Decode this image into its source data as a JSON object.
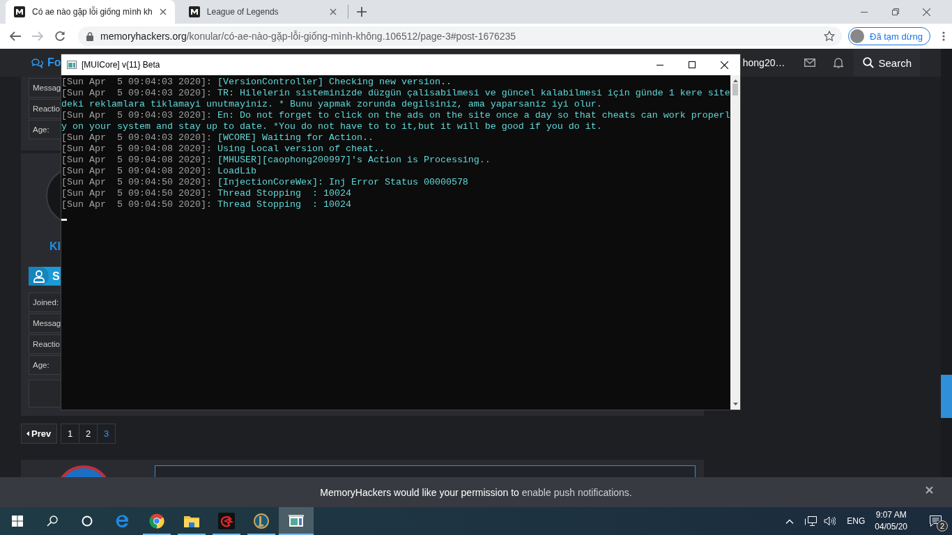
{
  "browser": {
    "tabs": [
      {
        "title": "Có ae nào gặp lỗi giống mình kh",
        "selected": true
      },
      {
        "title": "League of Legends",
        "selected": false
      }
    ],
    "address": {
      "host": "memoryhackers.org",
      "path": "/konular/có-ae-nào-gặp-lỗi-giống-mình-không.106512/page-3#post-1676235"
    },
    "profile": {
      "label": "Đã tạm dừng"
    }
  },
  "forum": {
    "nav": {
      "brand": "Fo",
      "user": "hong20…",
      "search": "Search"
    },
    "posts": [
      {
        "fields": [
          "Messag",
          "Reactio",
          "Age:"
        ]
      },
      {
        "name": "KI",
        "banner": "S",
        "fields": [
          "Joined:",
          "Messag",
          "Reactio",
          "Age:"
        ]
      }
    ],
    "pagination": {
      "prev": "Prev",
      "pages": [
        {
          "label": "1",
          "selected": false
        },
        {
          "label": "2",
          "selected": false
        },
        {
          "label": "3",
          "selected": true
        }
      ]
    }
  },
  "console": {
    "title": "[MUICore] v{11} Beta",
    "lines": [
      {
        "time": "[Sun Apr  5 09:04:03 2020]:",
        "message": "[VersionController] Checking new version.."
      },
      {
        "time": "[Sun Apr  5 09:04:03 2020]:",
        "message": "TR: Hilelerin sisteminizde düzgün çalisabilmesi ve güncel kalabilmesi için günde 1 kere sitedeki reklamlara tiklamayi unutmayiniz. * Bunu yapmak zorunda degilsiniz, ama yaparsaniz iyi olur."
      },
      {
        "time": "[Sun Apr  5 09:04:03 2020]:",
        "message": "En: Do not forget to click on the ads on the site once a day so that cheats can work properly on your system and stay up to date. *You do not have to to it,but it will be good if you do it."
      },
      {
        "time": "[Sun Apr  5 09:04:03 2020]:",
        "message": "[WCORE] Waiting for Action.."
      },
      {
        "time": "[Sun Apr  5 09:04:08 2020]:",
        "message": "Using Local version of cheat.."
      },
      {
        "time": "[Sun Apr  5 09:04:08 2020]:",
        "message": "[MHUSER][caophong200997]'s Action is Processing.."
      },
      {
        "time": "[Sun Apr  5 09:04:08 2020]:",
        "message": "LoadLib"
      },
      {
        "time": "[Sun Apr  5 09:04:50 2020]:",
        "message": "[InjectionCoreWex]: Inj Error Status 00000578"
      },
      {
        "time": "[Sun Apr  5 09:04:50 2020]:",
        "message": "Thread Stopping  : 10024"
      },
      {
        "time": "[Sun Apr  5 09:04:50 2020]:",
        "message": "Thread Stopping  : 10024"
      }
    ]
  },
  "notification": {
    "text": "**MemoryHackers would like your permission to** enable push notifications."
  },
  "taskbar": {
    "apps": [
      {
        "kind": "edge",
        "running": false,
        "selected": false
      },
      {
        "kind": "chrome",
        "running": true,
        "selected": false
      },
      {
        "kind": "explorer",
        "running": true,
        "selected": false
      },
      {
        "kind": "garena",
        "running": true,
        "selected": false
      },
      {
        "kind": "league",
        "running": true,
        "selected": false
      },
      {
        "kind": "console",
        "running": true,
        "selected": true
      }
    ],
    "tray": {
      "language": "ENG",
      "time": "9:07 AM",
      "date": "04/05/20",
      "notifications": "2"
    }
  }
}
